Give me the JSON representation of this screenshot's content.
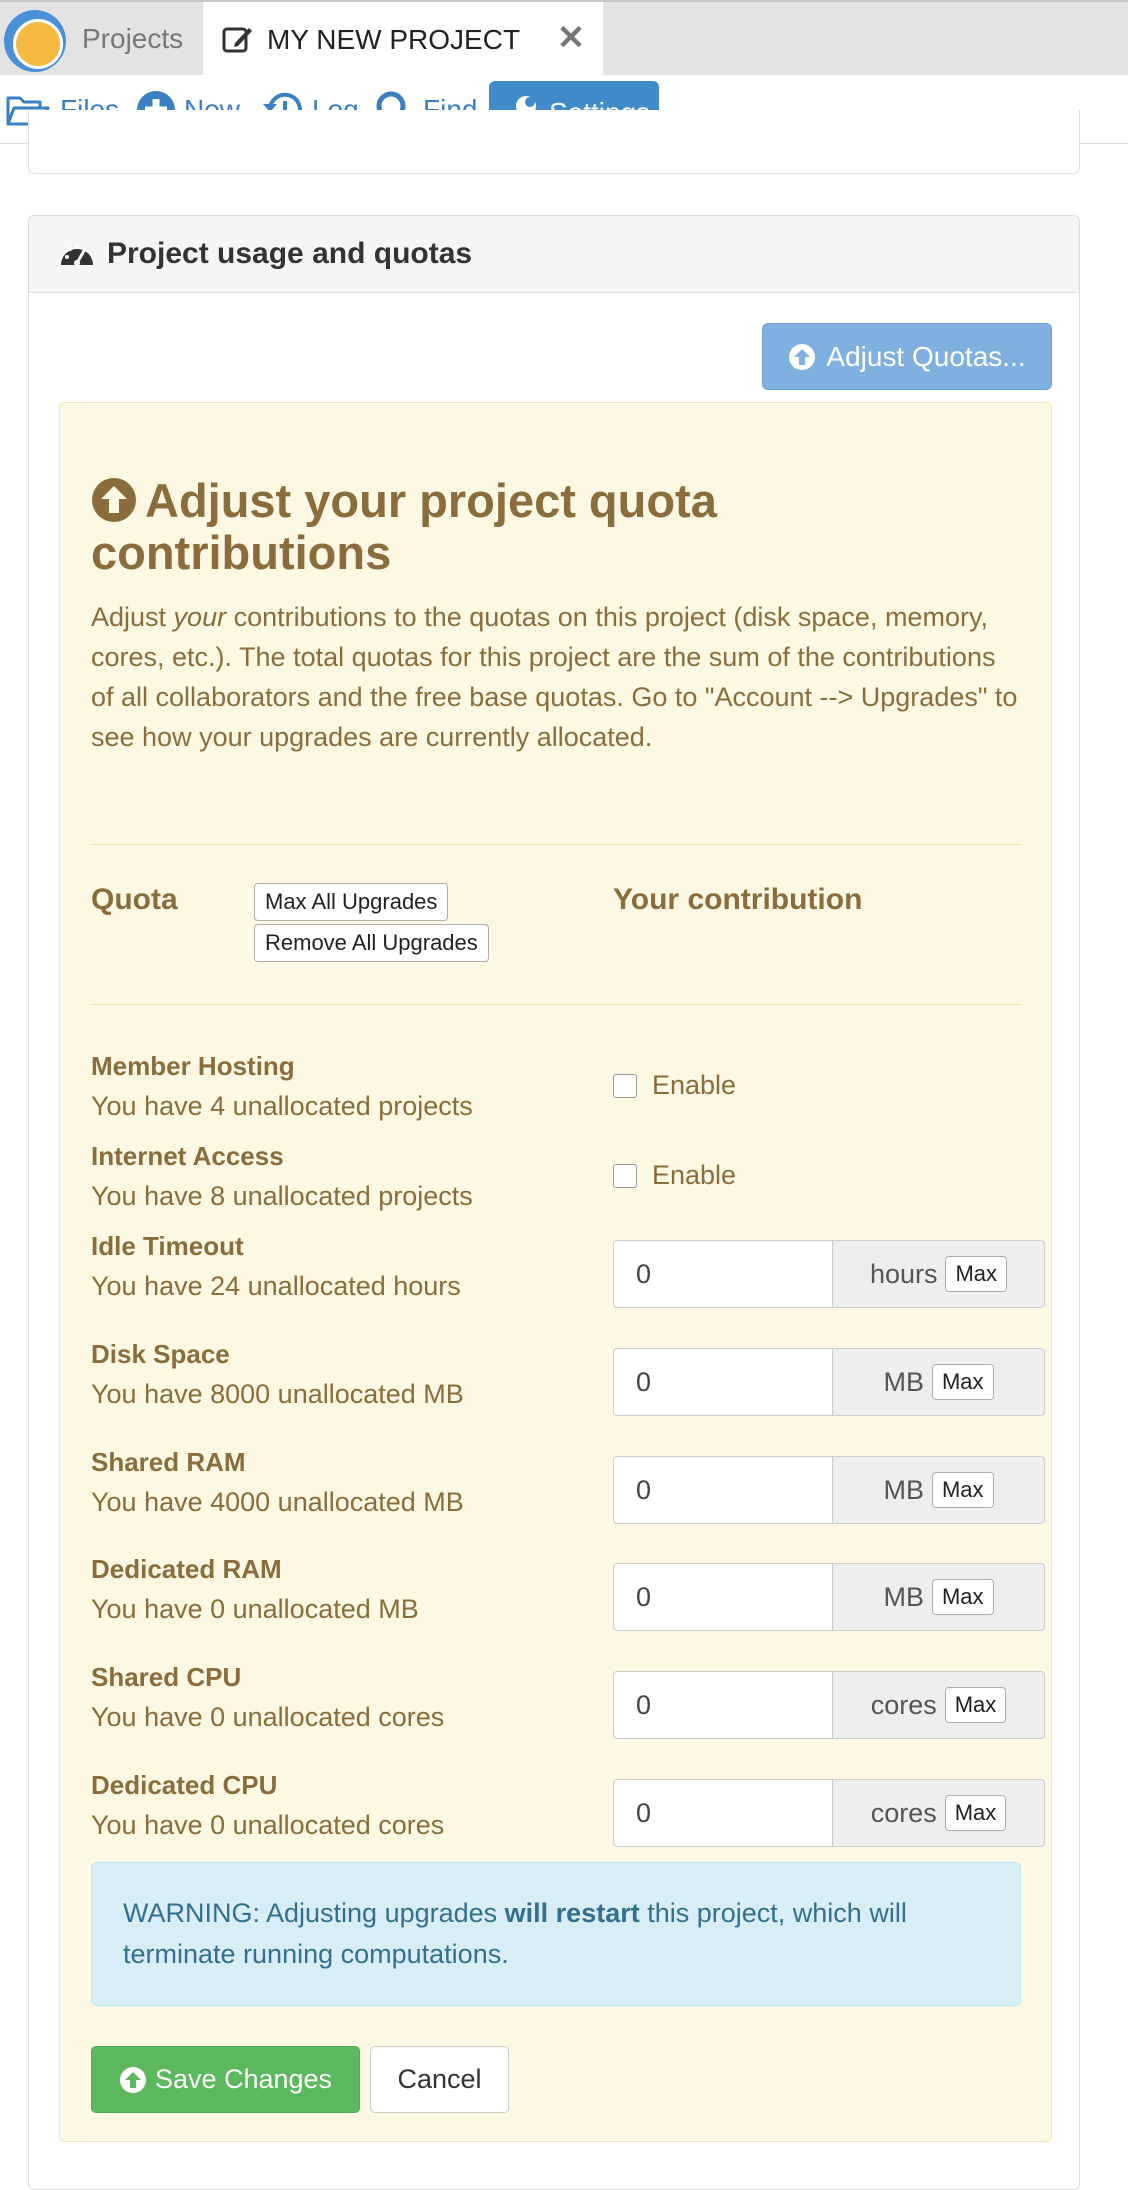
{
  "tabs": {
    "projects_label": "Projects",
    "active_label": "MY NEW PROJECT",
    "close_glyph": "✕"
  },
  "nav": {
    "files": "Files",
    "new": "New",
    "log": "Log",
    "find": "Find",
    "settings": "Settings"
  },
  "panel": {
    "heading": "Project usage and quotas",
    "adjust_button": "Adjust Quotas..."
  },
  "quota": {
    "title": "Adjust your project quota contributions",
    "desc_before": "Adjust ",
    "desc_em": "your",
    "desc_after": " contributions to the quotas on this project (disk space, memory, cores, etc.). The total quotas for this project are the sum of the contributions of all collaborators and the free base quotas. Go to \"Account --> Upgrades\" to see how your upgrades are currently allocated.",
    "col_quota": "Quota",
    "col_contribution": "Your contribution",
    "max_all": "Max All Upgrades",
    "remove_all": "Remove All Upgrades",
    "rows": [
      {
        "name": "Member Hosting",
        "sub": "You have 4 unallocated projects",
        "type": "checkbox",
        "label": "Enable",
        "checked": false
      },
      {
        "name": "Internet Access",
        "sub": "You have 8 unallocated projects",
        "type": "checkbox",
        "label": "Enable",
        "checked": false
      },
      {
        "name": "Idle Timeout",
        "sub": "You have 24 unallocated hours",
        "type": "input",
        "value": "0",
        "unit": "hours",
        "max": "Max"
      },
      {
        "name": "Disk Space",
        "sub": "You have 8000 unallocated MB",
        "type": "input",
        "value": "0",
        "unit": "MB",
        "max": "Max"
      },
      {
        "name": "Shared RAM",
        "sub": "You have 4000 unallocated MB",
        "type": "input",
        "value": "0",
        "unit": "MB",
        "max": "Max"
      },
      {
        "name": "Dedicated RAM",
        "sub": "You have 0 unallocated MB",
        "type": "input",
        "value": "0",
        "unit": "MB",
        "max": "Max"
      },
      {
        "name": "Shared CPU",
        "sub": "You have 0 unallocated cores",
        "type": "input",
        "value": "0",
        "unit": "cores",
        "max": "Max"
      },
      {
        "name": "Dedicated CPU",
        "sub": "You have 0 unallocated cores",
        "type": "input",
        "value": "0",
        "unit": "cores",
        "max": "Max"
      }
    ],
    "warning_before": "WARNING: Adjusting upgrades ",
    "warning_bold": "will restart",
    "warning_after": " this project, which will terminate running computations.",
    "save": "Save Changes",
    "cancel": "Cancel"
  },
  "colors": {
    "accent": "#428bca",
    "warning_text": "#8a6d3b",
    "warning_bg": "#fcf8e3",
    "info_bg": "#d9edf7",
    "success": "#5cb85c"
  }
}
